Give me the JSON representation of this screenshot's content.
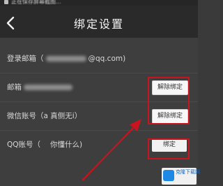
{
  "status_bar": {
    "notification": "正在保存屏幕截图..."
  },
  "header": {
    "title": "绑定设置",
    "back_icon": "back-arrow-icon"
  },
  "rows": [
    {
      "label": "登录邮箱（",
      "suffix": "@qq.com)"
    },
    {
      "label": "邮箱",
      "action": "解除绑定"
    },
    {
      "label": "微信账号（a 真侧无i）",
      "action": "解除绑定"
    },
    {
      "label": "QQ账号（",
      "label_suffix": "你懂什么)",
      "action": "绑定"
    }
  ],
  "watermark": {
    "name": "克隆下载网",
    "brand_color": "#1e88e5"
  },
  "annotation": {
    "color": "#c8141e"
  }
}
